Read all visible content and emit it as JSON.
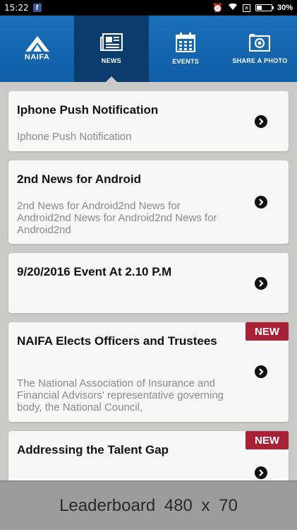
{
  "status_bar": {
    "time": "15:22",
    "battery_label": "30%",
    "battery_level": 0.3
  },
  "nav": {
    "logo_text": "NAIFA",
    "tabs": [
      {
        "label": "NEWS",
        "icon": "newspaper-icon",
        "active": true
      },
      {
        "label": "EVENTS",
        "icon": "calendar-icon",
        "active": false
      },
      {
        "label": "SHARE A PHOTO",
        "icon": "camera-icon",
        "active": false
      }
    ]
  },
  "news": [
    {
      "title": "Iphone Push Notification",
      "body": "Iphone Push Notification",
      "is_new": false
    },
    {
      "title": "2nd News for Android",
      "body": "2nd News for Android2nd News for Android2nd News for Android2nd News for Android2nd",
      "is_new": false
    },
    {
      "title": "9/20/2016 Event At 2.10 P.M",
      "body": "",
      "is_new": false
    },
    {
      "title": "NAIFA Elects Officers and Trustees",
      "body": "The National Association of Insurance and Financial Advisors' representative governing body, the National Council,",
      "is_new": true,
      "badge": "NEW"
    },
    {
      "title": "Addressing the Talent Gap",
      "body": "",
      "is_new": true,
      "badge": "NEW"
    }
  ],
  "ad": {
    "label": "Leaderboard  480 x 70"
  },
  "colors": {
    "nav_blue": "#1a6fb8",
    "nav_active": "#0a3d6d",
    "new_badge": "#a82237",
    "background": "#c9cac8"
  }
}
